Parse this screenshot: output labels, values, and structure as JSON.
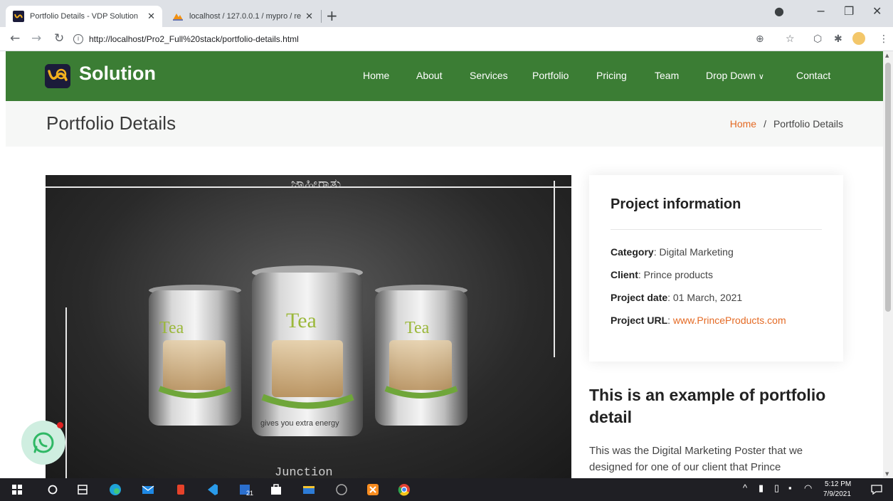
{
  "browser": {
    "tabs": [
      {
        "title": "Portfolio Details - VDP Solution",
        "active": true
      },
      {
        "title": "localhost / 127.0.0.1 / mypro / re",
        "active": false
      }
    ],
    "url": "http://localhost/Pro2_Full%20stack/portfolio-details.html"
  },
  "site": {
    "logo_text": "Solution",
    "nav": [
      "Home",
      "About",
      "Services",
      "Portfolio",
      "Pricing",
      "Team",
      "Drop Down",
      "Contact"
    ],
    "nav_dropdown_caret": "∨"
  },
  "breadcrumb": {
    "page_title": "Portfolio Details",
    "home": "Home",
    "separator": "/",
    "current": "Portfolio Details"
  },
  "poster": {
    "top_text": "ಜಾಹೀರಾತು",
    "bottom_text": "Junction",
    "can_label": "Tea",
    "tagline": "gives you extra energy"
  },
  "project_info": {
    "heading": "Project information",
    "category_label": "Category",
    "category_value": "Digital Marketing",
    "client_label": "Client",
    "client_value": "Prince products",
    "date_label": "Project date",
    "date_value": "01 March, 2021",
    "url_label": "Project URL",
    "url_value": "www.PrinceProducts.com"
  },
  "description": {
    "title": "This is an example of portfolio detail",
    "text": "This was the Digital Marketing Poster that we designed for one of our client that Prince"
  },
  "taskbar": {
    "time": "5:12 PM",
    "date": "7/9/2021",
    "badge": "21"
  },
  "colors": {
    "header_green": "#3b7d34",
    "accent_orange": "#e46a24",
    "taskbar": "#1f1f24"
  }
}
